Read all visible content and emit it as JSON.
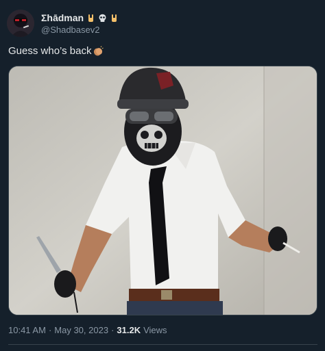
{
  "author": {
    "display_name": "Σhādman",
    "emoji_after_name": [
      "rock-on-hand",
      "skull",
      "rock-on-hand"
    ],
    "handle": "@Shadbasev2"
  },
  "tweet": {
    "text": "Guess who’s back",
    "trailing_emoji": "clapping-hands"
  },
  "meta": {
    "time": "10:41 AM",
    "separator": "·",
    "date": "May 30, 2023",
    "views_count": "31.2K",
    "views_label": "Views"
  },
  "colors": {
    "background": "#15202b",
    "primary_text": "#e7e9ea",
    "secondary_text": "#8b98a5",
    "border": "#38444d"
  }
}
